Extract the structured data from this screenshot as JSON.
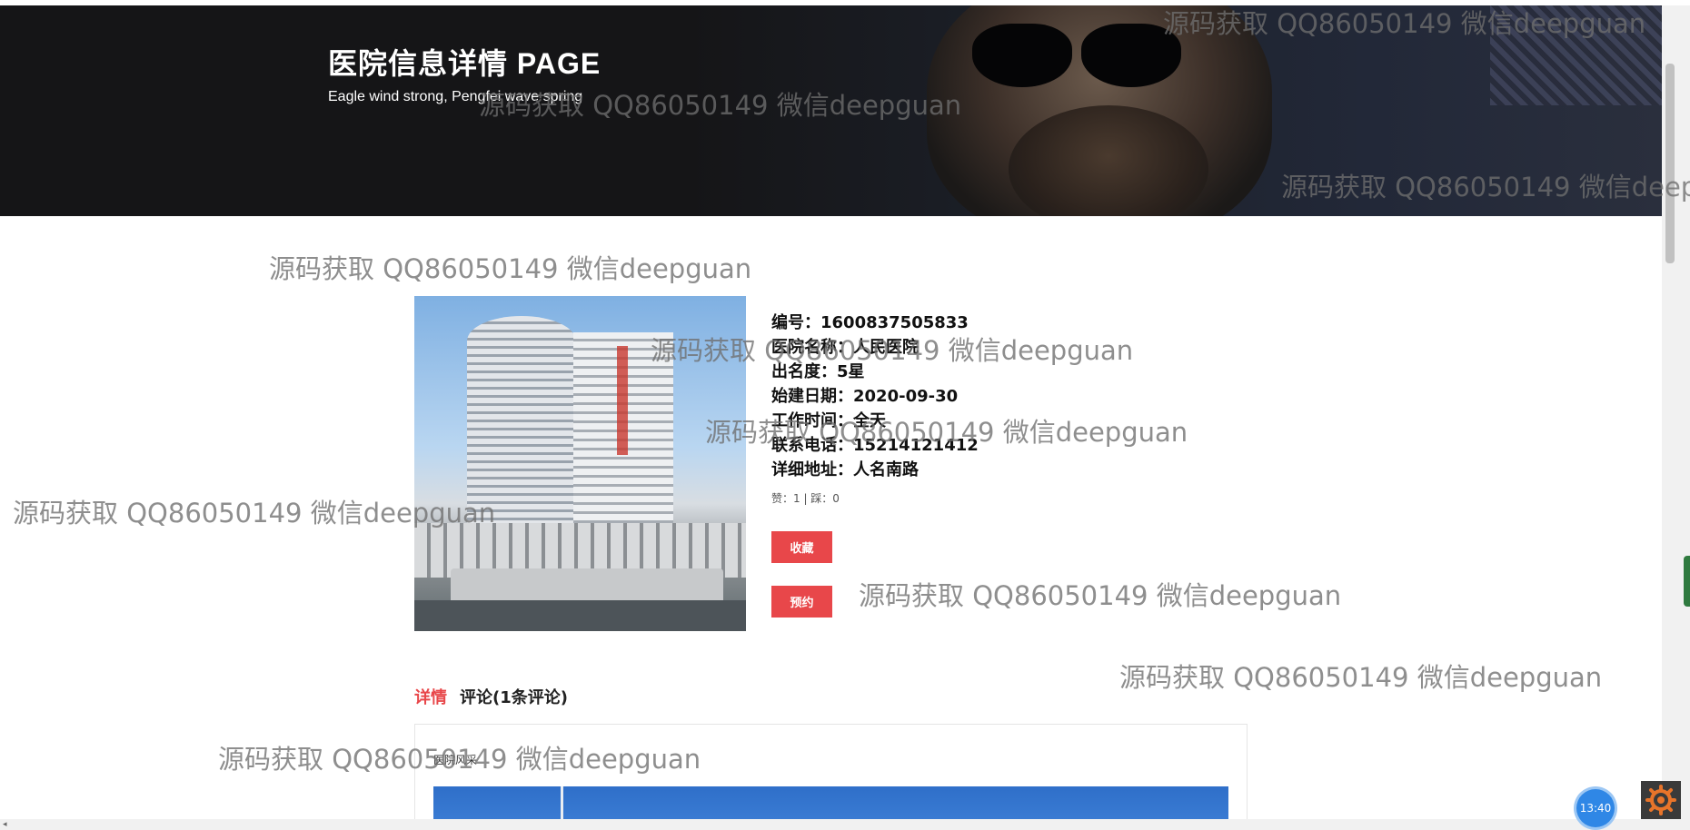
{
  "hero": {
    "title": "医院信息详情 PAGE",
    "subtitle": "Eagle wind strong, Pengfei wave spring"
  },
  "hospital": {
    "fields": [
      "编号：1600837505833",
      "医院名称：人民医院",
      "出名度：5星",
      "始建日期：2020-09-30",
      "工作时间：全天",
      "联系电话：15214121412",
      "详细地址：人名南路"
    ],
    "votes": "赞：1 | 踩：0"
  },
  "actions": {
    "favorite_label": "收藏",
    "book_label": "预约"
  },
  "tabs": {
    "detail_label": "详情",
    "comments_label": "评论(1条评论)"
  },
  "detail": {
    "section_label": "医院风采"
  },
  "watermark": {
    "text": "源码获取 QQ86050149 微信deepguan"
  },
  "taskbar": {
    "clock": "13:40"
  },
  "colors": {
    "accent": "#e8474a",
    "hero_bg": "#151517"
  }
}
